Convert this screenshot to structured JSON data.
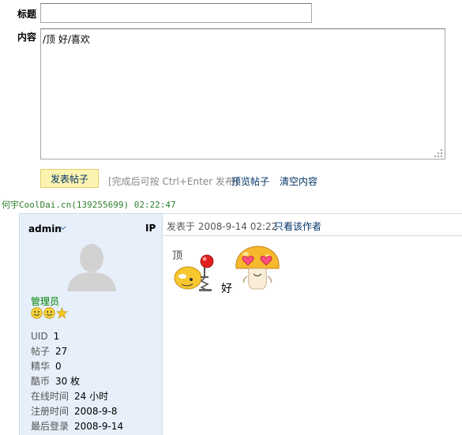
{
  "form": {
    "title_label": "标题",
    "content_label": "内容",
    "title_value": "",
    "content_value": "/顶 好/喜欢",
    "submit_label": "发表帖子",
    "hint": "[完成后可按 Ctrl+Enter 发布]",
    "preview_label": "预览帖子",
    "clear_label": "清空内容"
  },
  "signature_line": "何宇CoolDai.cn(139255699) 02:22:47",
  "post": {
    "author": "admin",
    "ip_label": "IP",
    "role": "管理员",
    "rank_icons": [
      "smiley-icon",
      "smiley-icon",
      "star-icon"
    ],
    "stats": [
      {
        "label": "UID",
        "value": "1"
      },
      {
        "label": "帖子",
        "value": "27"
      },
      {
        "label": "精华",
        "value": "0"
      },
      {
        "label": "酷币",
        "value": "30 枚"
      },
      {
        "label": "在线时间",
        "value": "24 小时"
      },
      {
        "label": "注册时间",
        "value": "2008-9-8"
      },
      {
        "label": "最后登录",
        "value": "2008-9-14"
      }
    ],
    "posted_at": "发表于 2008-9-14 02:22",
    "view_author_label": "只看该作者",
    "body_text": "好",
    "emoji_ding_caption": "顶"
  },
  "colors": {
    "link": "#003366",
    "sidebar_bg": "#e6effa",
    "border": "#cfdbe8",
    "role_green": "#008000",
    "signature_green": "#2e7d2e",
    "submit_bg": "#fbf3b0"
  }
}
